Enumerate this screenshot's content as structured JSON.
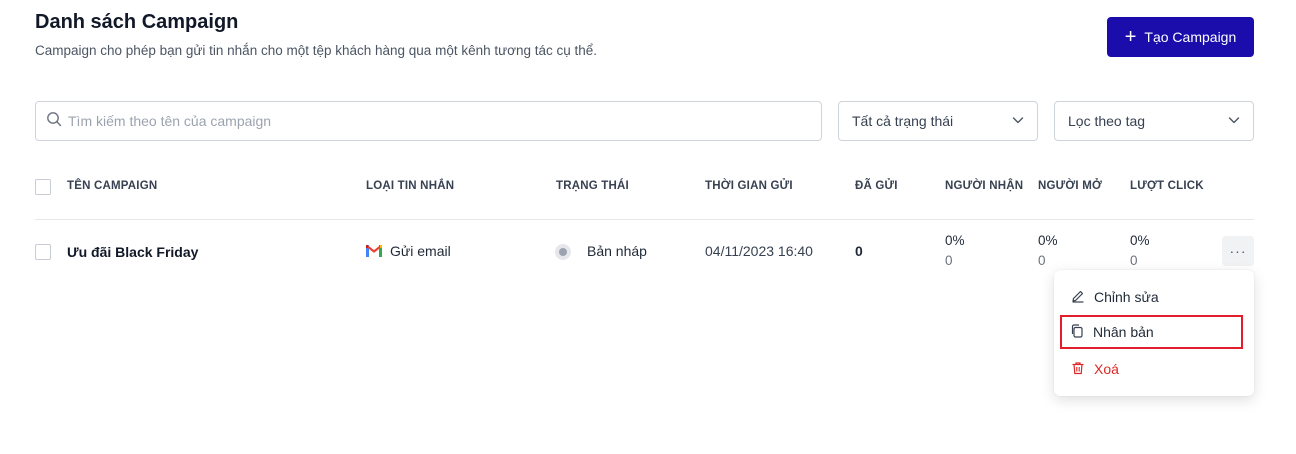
{
  "header": {
    "title": "Danh sách Campaign",
    "subtitle": "Campaign cho phép bạn gửi tin nhắn cho một tệp khách hàng qua một kênh tương tác cụ thể.",
    "create_button": "Tạo Campaign"
  },
  "filters": {
    "search_placeholder": "Tìm kiếm theo tên của campaign",
    "status_select": "Tất cả trạng thái",
    "tag_select": "Lọc theo tag"
  },
  "table": {
    "columns": [
      "TÊN CAMPAIGN",
      "LOẠI TIN NHẮN",
      "TRẠNG THÁI",
      "THỜI GIAN GỬI",
      "ĐÃ GỬI",
      "NGƯỜI NHẬN",
      "NGƯỜI MỞ",
      "LƯỢT CLICK"
    ],
    "rows": [
      {
        "name": "Ưu đãi Black Friday",
        "type": "Gửi email",
        "type_icon": "gmail-icon",
        "status": "Bản nháp",
        "send_time": "04/11/2023 16:40",
        "sent": "0",
        "recipients_pct": "0%",
        "recipients": "0",
        "opens_pct": "0%",
        "opens": "0",
        "clicks_pct": "0%",
        "clicks": "0"
      }
    ]
  },
  "row_menu": {
    "items": [
      {
        "label": "Chỉnh sửa",
        "icon": "pencil-icon"
      },
      {
        "label": "Nhân bản",
        "icon": "copy-icon"
      },
      {
        "label": "Xoá",
        "icon": "trash-icon"
      }
    ]
  },
  "colors": {
    "primary": "#1a0dab",
    "danger": "#dc2626",
    "highlight_outline": "#e11d2e"
  }
}
